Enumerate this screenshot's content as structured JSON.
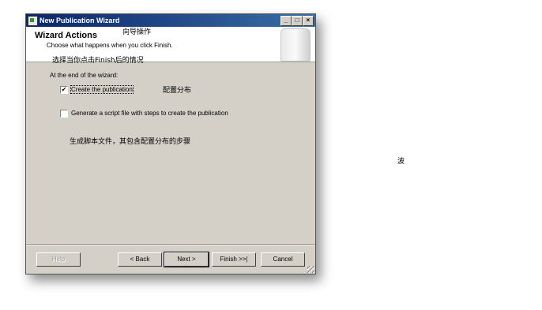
{
  "window": {
    "title": "New Publication Wizard",
    "controls": {
      "minimize": "_",
      "maximize": "□",
      "close": "×"
    }
  },
  "header": {
    "title": "Wizard Actions",
    "subtitle": "Choose what happens when you click Finish."
  },
  "annotations": {
    "wizard_ops": "向导操作",
    "finish_situation": "选择当你点击Finish后的情况",
    "configure_distribution": "配置分布",
    "script_note": "生成脚本文件，其包含配置分布的步骤",
    "wave": "波"
  },
  "body": {
    "section_label": "At the end of the wizard:",
    "options": [
      {
        "label": "Create the publication",
        "checked": true,
        "mark": "✔"
      },
      {
        "label": "Generate a script file with steps to create the publication",
        "checked": false,
        "mark": ""
      }
    ]
  },
  "buttons": {
    "help": "Help",
    "back": "< Back",
    "next": "Next >",
    "finish": "Finish >>|",
    "cancel": "Cancel"
  }
}
